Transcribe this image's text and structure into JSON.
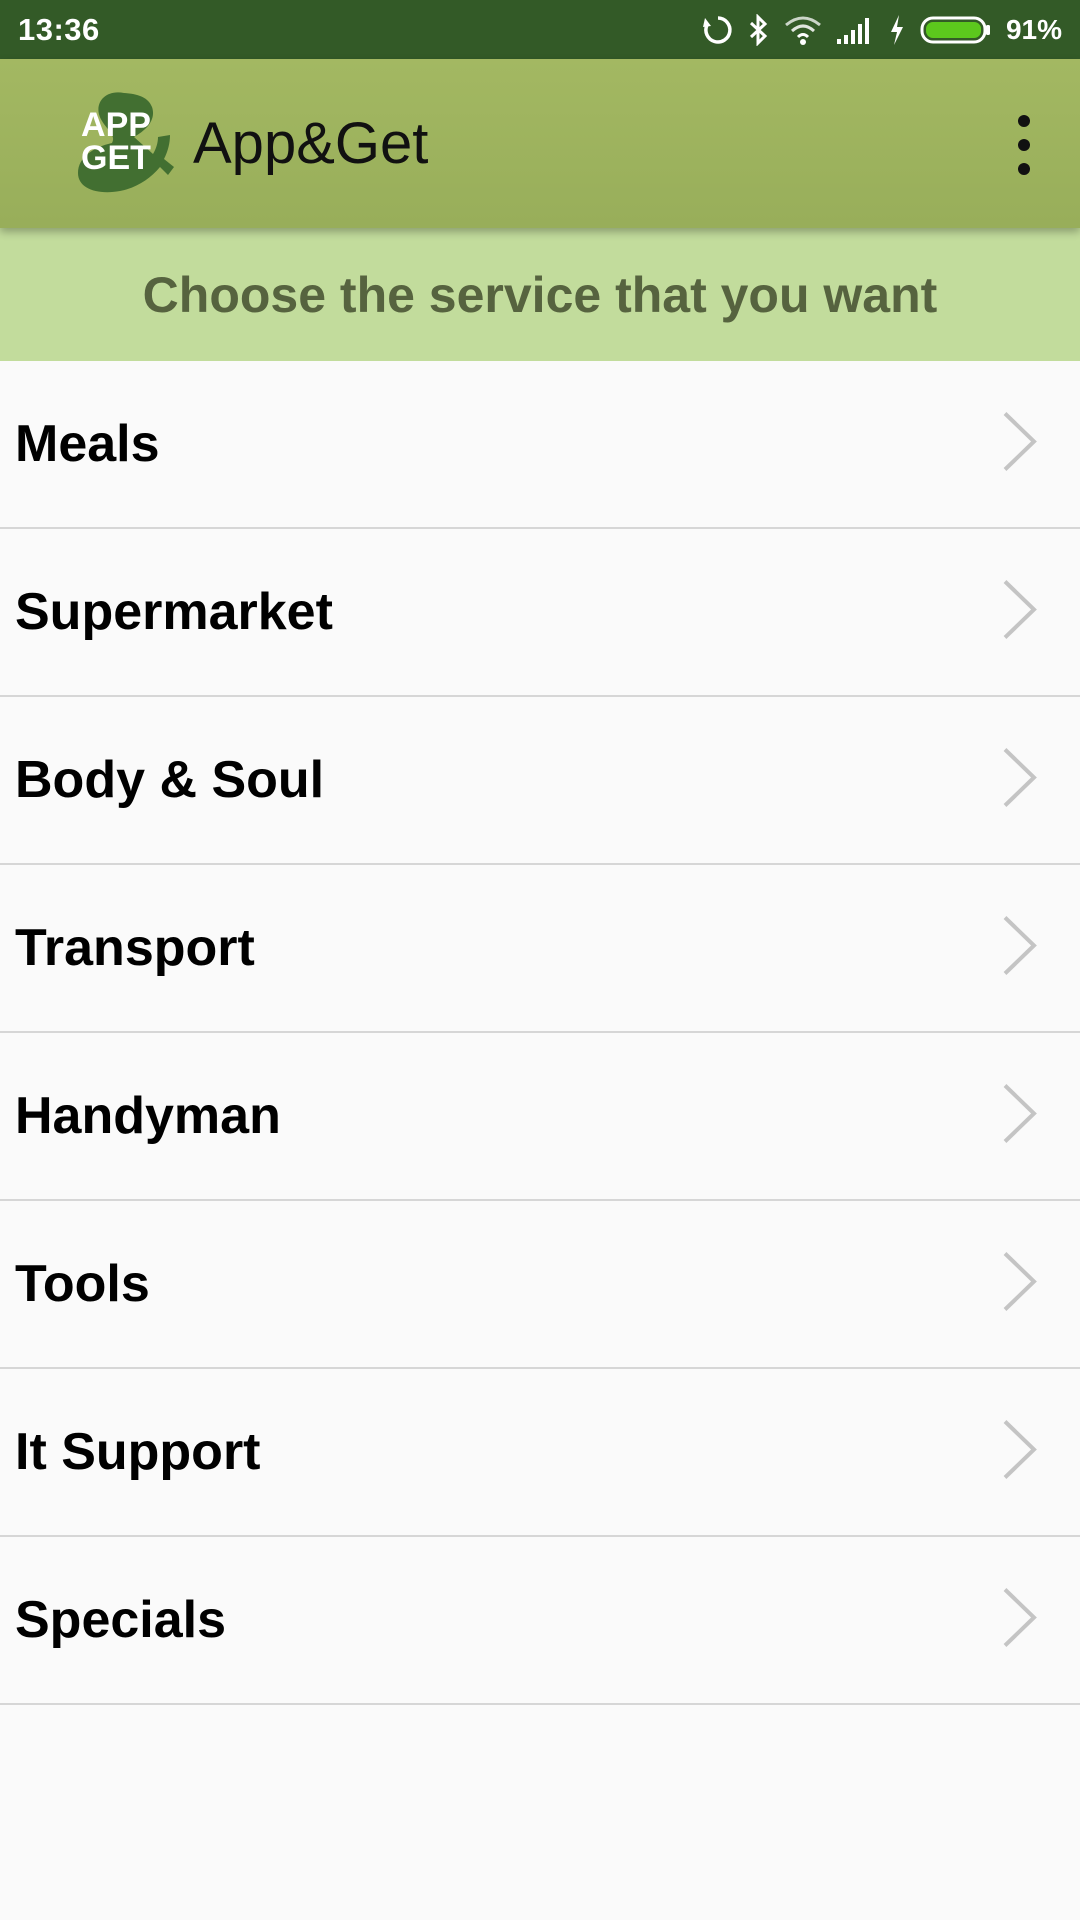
{
  "status_bar": {
    "time": "13:36",
    "battery_percent": "91%",
    "battery_level": 0.91,
    "icons": [
      "sync-icon",
      "bluetooth-icon",
      "wifi-icon",
      "signal-icon",
      "charging-icon",
      "battery-icon"
    ]
  },
  "app_bar": {
    "logo_text_line1": "APP",
    "logo_text_line2": "GET",
    "title": "App&Get",
    "menu_icon": "more-vert-icon"
  },
  "banner": {
    "text": "Choose the service that you want"
  },
  "services": [
    {
      "label": "Meals"
    },
    {
      "label": "Supermarket"
    },
    {
      "label": "Body & Soul"
    },
    {
      "label": "Transport"
    },
    {
      "label": "Handyman"
    },
    {
      "label": "Tools"
    },
    {
      "label": "It Support"
    },
    {
      "label": "Specials"
    }
  ],
  "colors": {
    "status_bar": "#335a27",
    "app_bar": "#9db25d",
    "banner_bg": "#c2dc9c",
    "banner_text": "#56633f",
    "logo_green": "#3d6b2e",
    "battery_fill": "#5cc81d",
    "chevron": "#c4c4c4"
  }
}
